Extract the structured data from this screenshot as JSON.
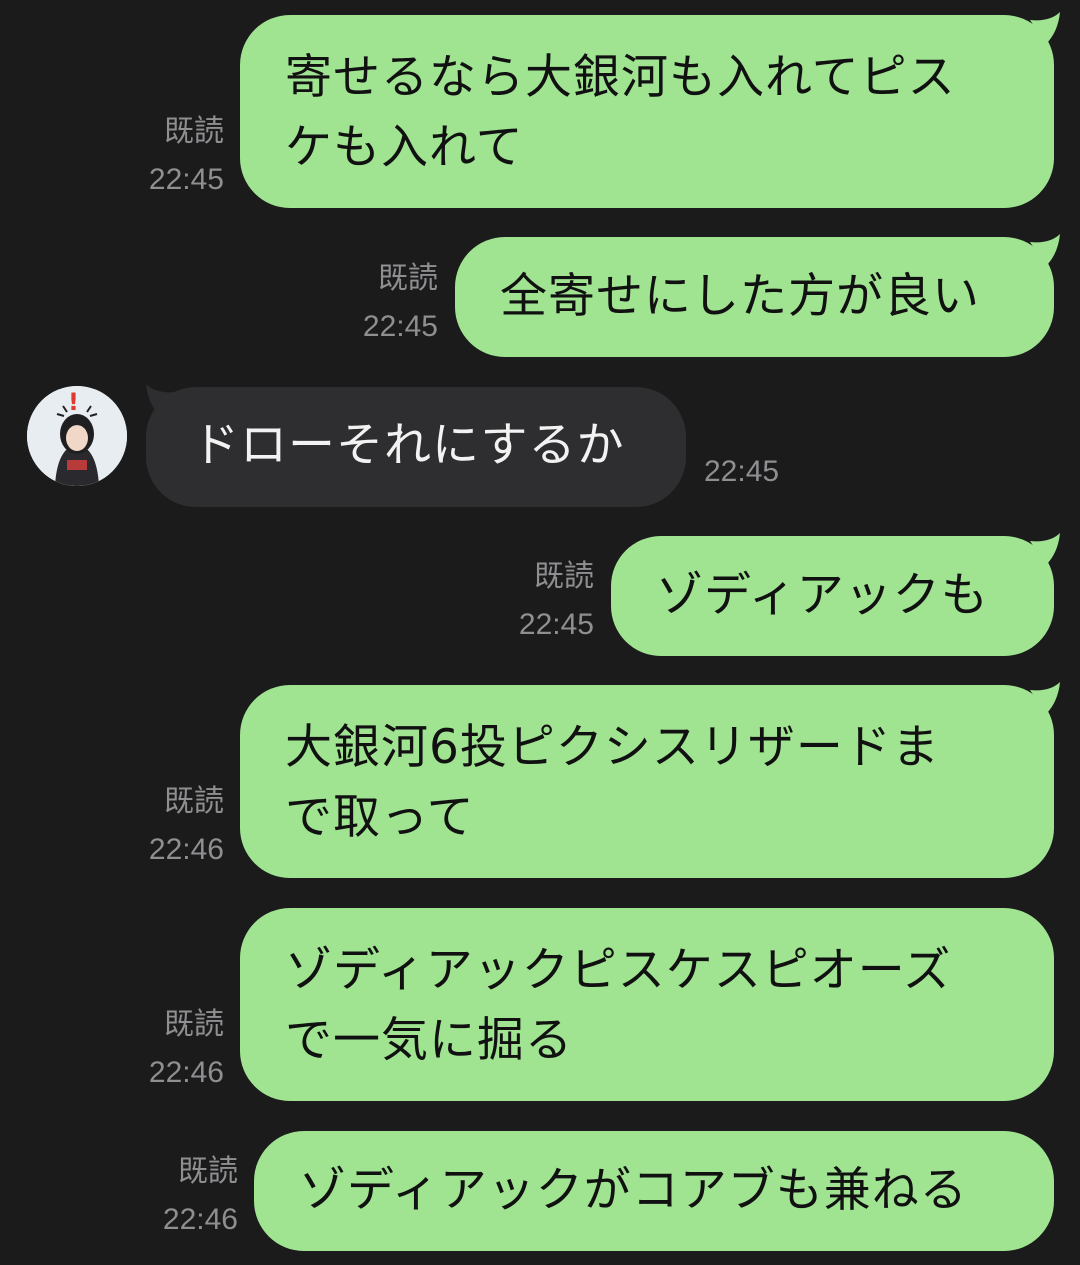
{
  "messages": [
    {
      "from": "me",
      "lines": [
        "寄せるなら大銀河も入れてピス",
        "ケも入れて"
      ],
      "read_label": "既読",
      "time": "22:45"
    },
    {
      "from": "me",
      "lines": [
        "全寄せにした方が良い"
      ],
      "read_label": "既読",
      "time": "22:45"
    },
    {
      "from": "other",
      "lines": [
        "ドローそれにするか"
      ],
      "time": "22:45"
    },
    {
      "from": "me",
      "lines": [
        "ゾディアックも"
      ],
      "read_label": "既読",
      "time": "22:45"
    },
    {
      "from": "me",
      "lines": [
        "大銀河6投ピクシスリザードま",
        "で取って"
      ],
      "read_label": "既読",
      "time": "22:46"
    },
    {
      "from": "me",
      "lines": [
        "ゾディアックピスケスピオーズ",
        "で一気に掘る"
      ],
      "read_label": "既読",
      "time": "22:46"
    },
    {
      "from": "me",
      "lines": [
        "ゾディアックがコアブも兼ねる"
      ],
      "read_label": "既読",
      "time": "22:46"
    }
  ],
  "avatar_marker": "!",
  "colors": {
    "background": "#1b1b1c",
    "sent_bubble": "#a0e492",
    "received_bubble": "#2e2e30",
    "meta_text": "#8f8f92"
  }
}
